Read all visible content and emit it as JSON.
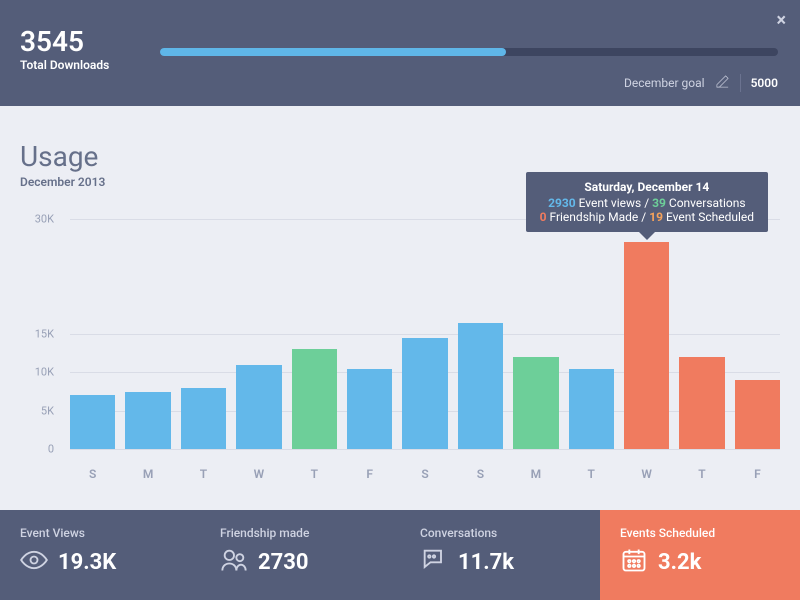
{
  "header": {
    "downloads_value": "3545",
    "downloads_label": "Total Downloads",
    "goal_label": "December goal",
    "goal_value": "5000",
    "progress_pct": 56
  },
  "usage": {
    "title": "Usage",
    "subtitle": "December 2013"
  },
  "chart_data": {
    "type": "bar",
    "categories": [
      "S",
      "M",
      "T",
      "W",
      "T",
      "F",
      "S",
      "S",
      "M",
      "T",
      "W",
      "T",
      "F"
    ],
    "values": [
      7,
      7.5,
      8,
      11,
      13,
      10.5,
      14.5,
      16.5,
      12,
      10.5,
      27,
      12,
      9
    ],
    "colors": [
      "blue",
      "blue",
      "blue",
      "blue",
      "green",
      "blue",
      "blue",
      "blue",
      "green",
      "blue",
      "orange",
      "orange",
      "orange"
    ],
    "ylabel": "",
    "xlabel": "",
    "ylim": [
      0,
      30
    ],
    "y_ticks": [
      {
        "v": 0,
        "label": "0"
      },
      {
        "v": 5,
        "label": "5K"
      },
      {
        "v": 10,
        "label": "10K"
      },
      {
        "v": 15,
        "label": "15K"
      },
      {
        "v": 30,
        "label": "30K"
      }
    ],
    "title": "Usage"
  },
  "tooltip": {
    "date": "Saturday, December 14",
    "event_views": "2930",
    "event_views_label": "Event views",
    "conversations": "39",
    "conversations_label": "Conversations",
    "friendship": "0",
    "friendship_label": "Friendship Made",
    "scheduled": "19",
    "scheduled_label": "Event Scheduled"
  },
  "stats": [
    {
      "label": "Event Views",
      "value": "19.3K",
      "icon": "eye"
    },
    {
      "label": "Friendship made",
      "value": "2730",
      "icon": "people"
    },
    {
      "label": "Conversations",
      "value": "11.7k",
      "icon": "chat"
    },
    {
      "label": "Events Scheduled",
      "value": "3.2k",
      "icon": "calendar",
      "active": true
    }
  ]
}
